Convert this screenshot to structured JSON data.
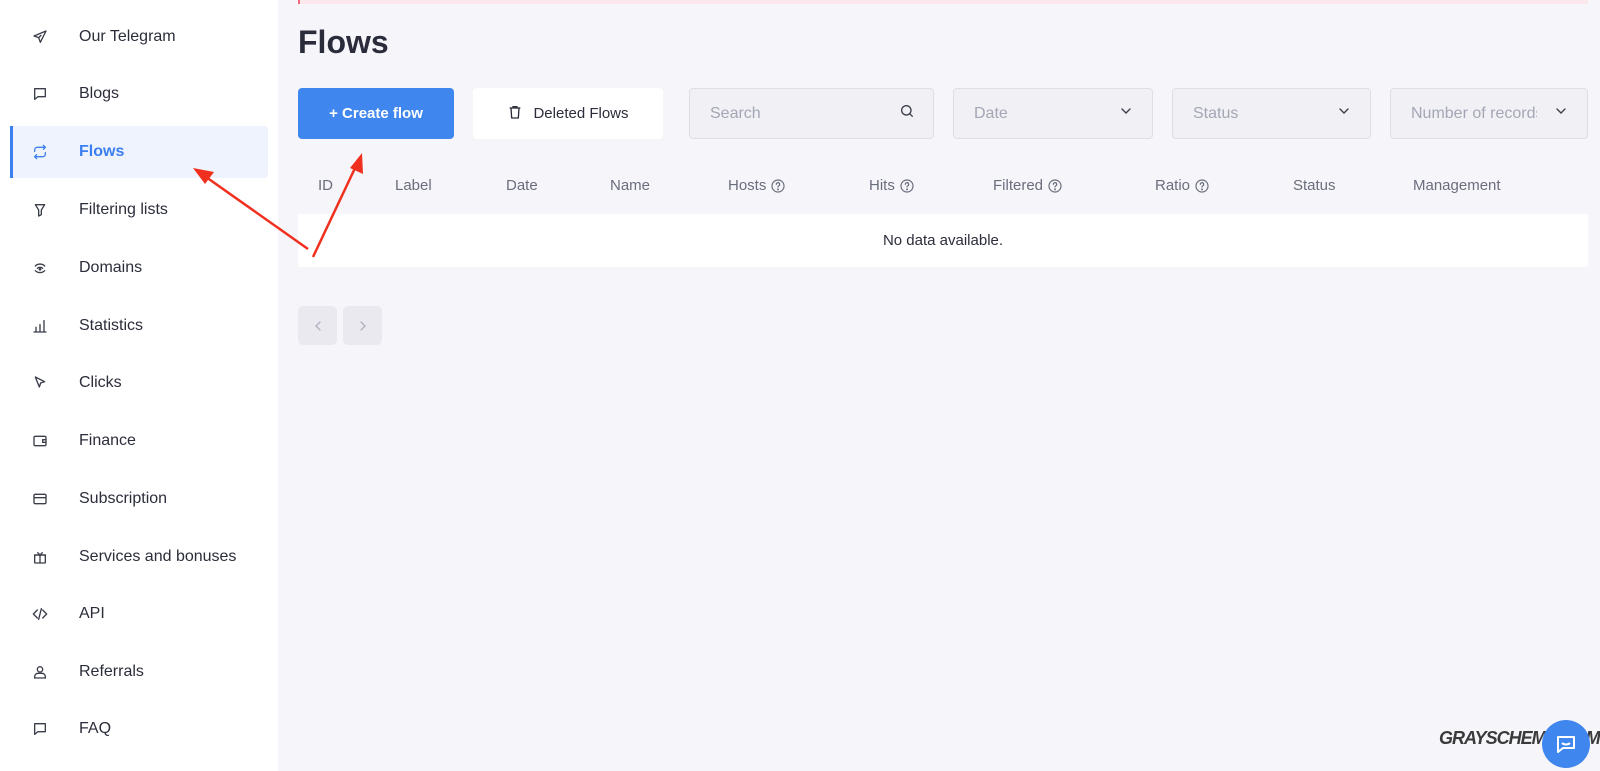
{
  "sidebar": {
    "items": [
      {
        "label": "Our Telegram",
        "icon": "telegram-icon"
      },
      {
        "label": "Blogs",
        "icon": "chat-bubble-icon"
      },
      {
        "label": "Flows",
        "icon": "repeat-icon",
        "active": true
      },
      {
        "label": "Filtering lists",
        "icon": "filter-icon"
      },
      {
        "label": "Domains",
        "icon": "wifi-icon"
      },
      {
        "label": "Statistics",
        "icon": "bar-chart-icon"
      },
      {
        "label": "Clicks",
        "icon": "cursor-icon"
      },
      {
        "label": "Finance",
        "icon": "wallet-icon"
      },
      {
        "label": "Subscription",
        "icon": "credit-card-icon"
      },
      {
        "label": "Services and bonuses",
        "icon": "gift-icon"
      },
      {
        "label": "API",
        "icon": "code-icon"
      },
      {
        "label": "Referrals",
        "icon": "user-icon"
      },
      {
        "label": "FAQ",
        "icon": "message-icon"
      }
    ]
  },
  "main": {
    "title": "Flows",
    "create_button": "+ Create flow",
    "deleted_button": "Deleted Flows",
    "search_placeholder": "Search",
    "date_filter": "Date",
    "status_filter": "Status",
    "records_filter": "Number of records",
    "table": {
      "columns": [
        "ID",
        "Label",
        "Date",
        "Name",
        "Hosts",
        "Hits",
        "Filtered",
        "Ratio",
        "Status",
        "Management"
      ],
      "empty_message": "No data available."
    }
  },
  "watermark": "GRAYSCHEME.COM",
  "colors": {
    "accent": "#3f86ee",
    "annotation_arrow": "#f0301e",
    "background": "#f6f6fa"
  }
}
